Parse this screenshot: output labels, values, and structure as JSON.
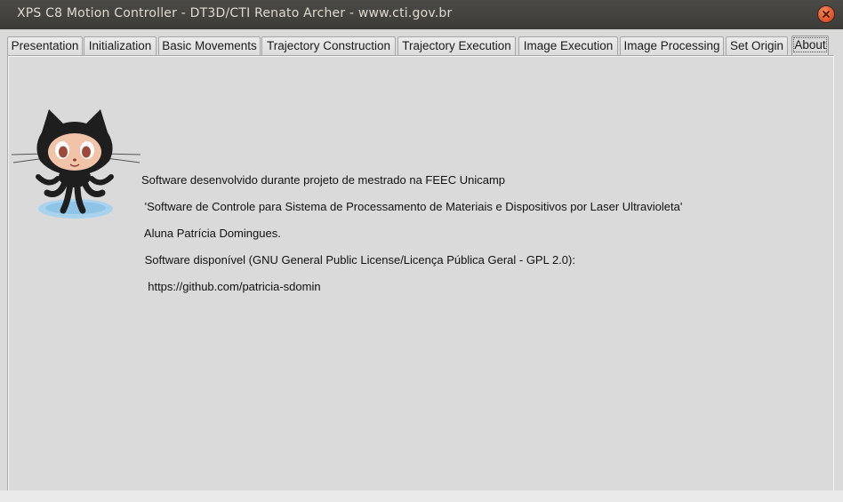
{
  "window": {
    "title": "XPS C8 Motion Controller - DT3D/CTI Renato Archer - www.cti.gov.br"
  },
  "tabs": [
    {
      "label": "Presentation"
    },
    {
      "label": "Initialization"
    },
    {
      "label": "Basic Movements"
    },
    {
      "label": "Trajectory Construction"
    },
    {
      "label": "Trajectory Execution"
    },
    {
      "label": "Image Execution"
    },
    {
      "label": "Image Processing"
    },
    {
      "label": "Set Origin"
    },
    {
      "label": "About",
      "active": true
    }
  ],
  "about": {
    "logo_icon": "octocat-icon",
    "lines": [
      "Software desenvolvido durante projeto de mestrado na FEEC Unicamp",
      " 'Software de Controle para Sistema de Processamento de Materiais e Dispositivos por Laser Ultravioleta'",
      " Aluna Patrícia Domingues.",
      " Software disponível (GNU General Public License/Licença Pública Geral - GPL 2.0):",
      "  https://github.com/patricia-sdomin"
    ]
  },
  "colors": {
    "titlebar": "#3c3b37",
    "close_button": "#e0522a",
    "window_bg": "#dadada"
  }
}
